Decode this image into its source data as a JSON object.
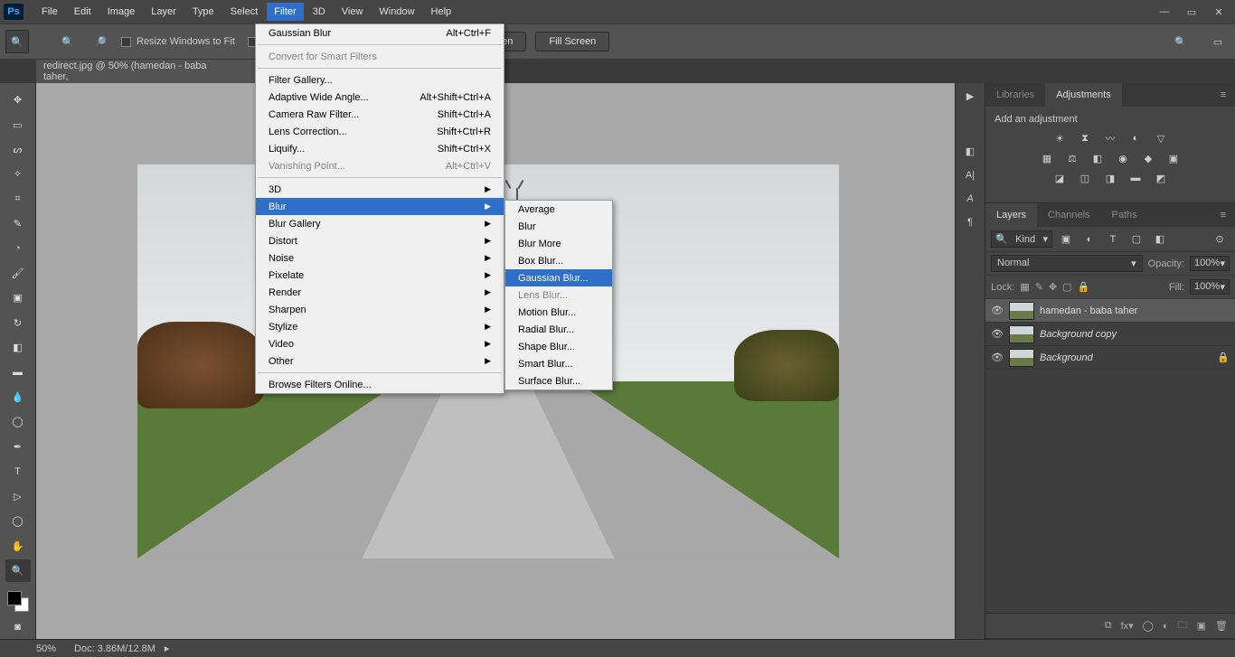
{
  "app": {
    "logo": "Ps"
  },
  "menu": [
    "File",
    "Edit",
    "Image",
    "Layer",
    "Type",
    "Select",
    "Filter",
    "3D",
    "View",
    "Window",
    "Help"
  ],
  "activeMenuIndex": 6,
  "options": {
    "resize_label": "Resize Windows to Fit",
    "button_1": "creen",
    "button_2": "Fill Screen"
  },
  "document": {
    "tab_title": "redirect.jpg @ 50% (hamedan - baba taher,"
  },
  "filter_menu": {
    "recent": {
      "label": "Gaussian Blur",
      "shortcut": "Alt+Ctrl+F"
    },
    "convert": "Convert for Smart Filters",
    "group1": [
      {
        "label": "Filter Gallery...",
        "shortcut": ""
      },
      {
        "label": "Adaptive Wide Angle...",
        "shortcut": "Alt+Shift+Ctrl+A"
      },
      {
        "label": "Camera Raw Filter...",
        "shortcut": "Shift+Ctrl+A"
      },
      {
        "label": "Lens Correction...",
        "shortcut": "Shift+Ctrl+R"
      },
      {
        "label": "Liquify...",
        "shortcut": "Shift+Ctrl+X"
      },
      {
        "label": "Vanishing Point...",
        "shortcut": "Alt+Ctrl+V",
        "disabled": true
      }
    ],
    "group2": [
      "3D",
      "Blur",
      "Blur Gallery",
      "Distort",
      "Noise",
      "Pixelate",
      "Render",
      "Sharpen",
      "Stylize",
      "Video",
      "Other"
    ],
    "highlight2": 1,
    "browse": "Browse Filters Online..."
  },
  "blur_submenu": {
    "items": [
      "Average",
      "Blur",
      "Blur More",
      "Box Blur...",
      "Gaussian Blur...",
      "Lens Blur...",
      "Motion Blur...",
      "Radial Blur...",
      "Shape Blur...",
      "Smart Blur...",
      "Surface Blur..."
    ],
    "highlight": 4,
    "disabled": [
      5
    ]
  },
  "panels": {
    "libraries": "Libraries",
    "adjustments": "Adjustments",
    "adj_prompt": "Add an adjustment",
    "layers": "Layers",
    "channels": "Channels",
    "paths": "Paths",
    "kind_label": "Kind",
    "blend_mode": "Normal",
    "opacity_label": "Opacity:",
    "opacity_value": "100%",
    "lock_label": "Lock:",
    "fill_label": "Fill:",
    "fill_value": "100%",
    "layer_rows": [
      {
        "name": "hamedan - baba taher",
        "selected": true,
        "italic": false
      },
      {
        "name": "Background copy",
        "selected": false,
        "italic": true
      },
      {
        "name": "Background",
        "selected": false,
        "italic": true,
        "locked": true
      }
    ]
  },
  "status": {
    "zoom": "50%",
    "doc": "Doc: 3.86M/12.8M"
  }
}
